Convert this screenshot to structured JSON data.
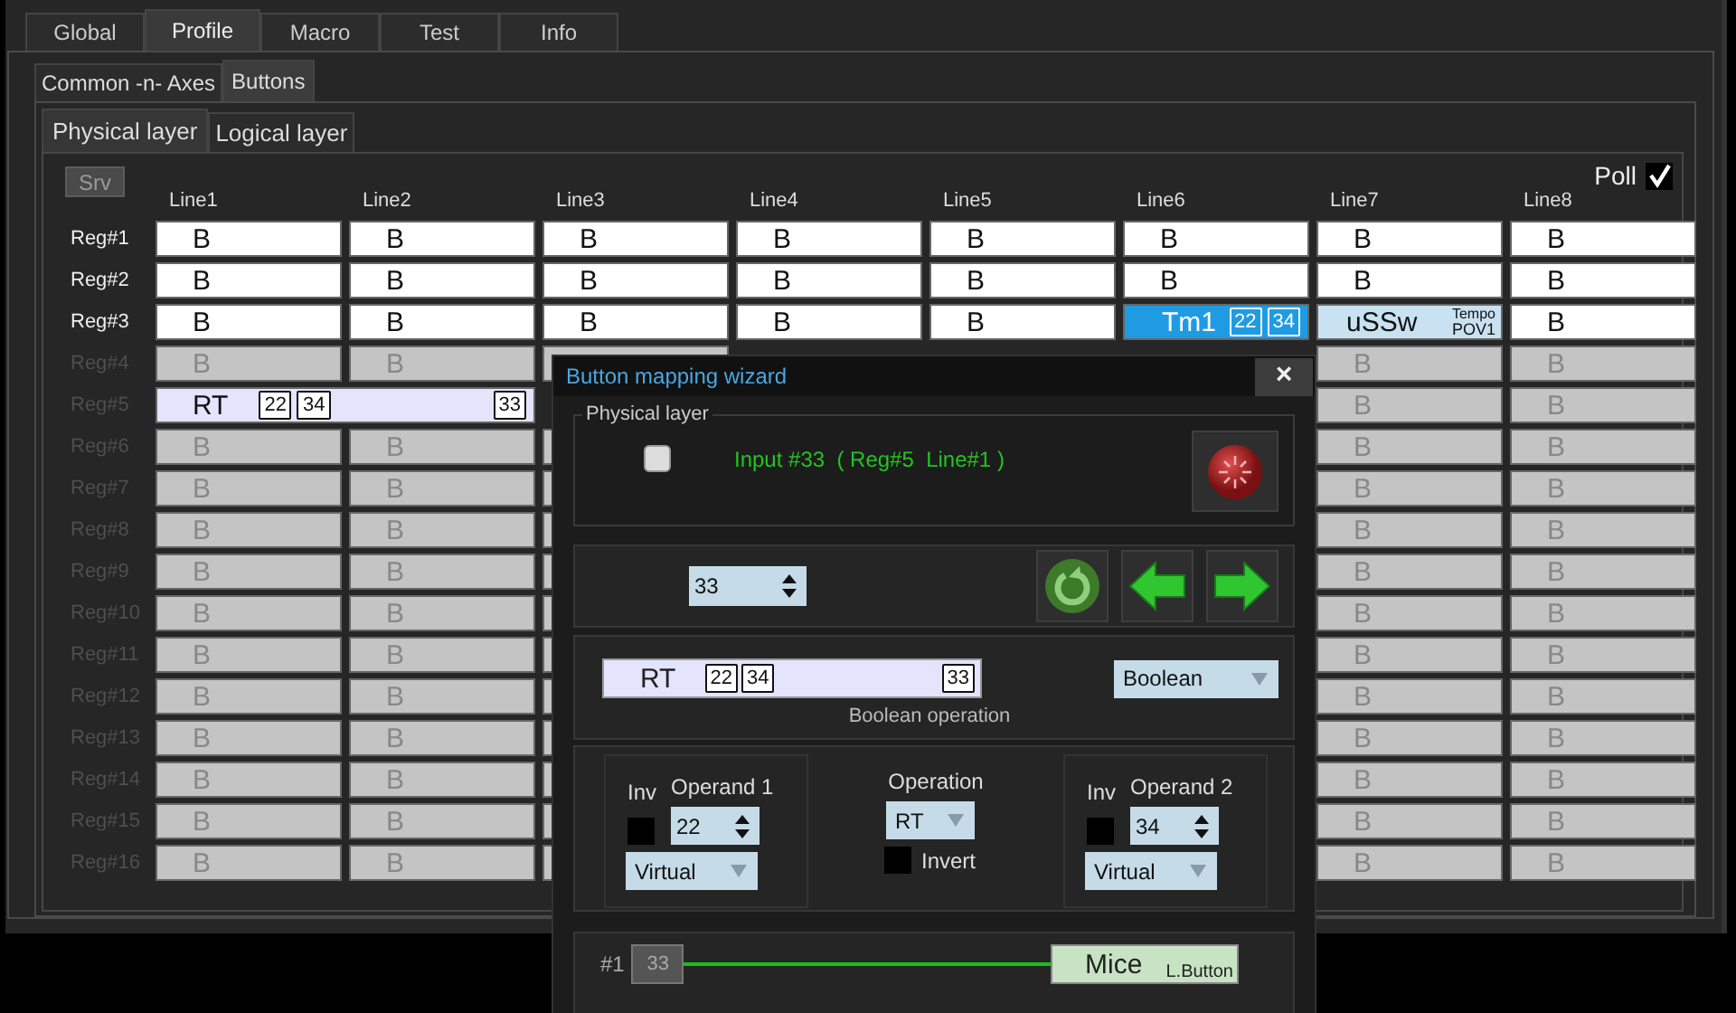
{
  "tabs": [
    {
      "label": "Global",
      "selected": false
    },
    {
      "label": "Profile",
      "selected": true
    },
    {
      "label": "Macro",
      "selected": false
    },
    {
      "label": "Test",
      "selected": false
    },
    {
      "label": "Info",
      "selected": false
    }
  ],
  "subtabs": [
    {
      "label": "Common -n- Axes",
      "selected": false
    },
    {
      "label": "Buttons",
      "selected": true
    }
  ],
  "layer_tabs": [
    {
      "label": "Physical layer",
      "selected": true
    },
    {
      "label": "Logical layer",
      "selected": false
    }
  ],
  "srv_button": "Srv",
  "poll": {
    "label": "Poll",
    "checked": true
  },
  "grid": {
    "columns": [
      "Line1",
      "Line2",
      "Line3",
      "Line4",
      "Line5",
      "Line6",
      "Line7",
      "Line8"
    ],
    "rows": [
      {
        "label": "Reg#1",
        "disabled": false,
        "cells": [
          {
            "kind": "plain",
            "text": "B"
          },
          {
            "kind": "plain",
            "text": "B"
          },
          {
            "kind": "plain",
            "text": "B"
          },
          {
            "kind": "plain",
            "text": "B"
          },
          {
            "kind": "plain",
            "text": "B"
          },
          {
            "kind": "plain",
            "text": "B"
          },
          {
            "kind": "plain",
            "text": "B"
          },
          {
            "kind": "plain",
            "text": "B"
          }
        ]
      },
      {
        "label": "Reg#2",
        "disabled": false,
        "cells": [
          {
            "kind": "plain",
            "text": "B"
          },
          {
            "kind": "plain",
            "text": "B"
          },
          {
            "kind": "plain",
            "text": "B"
          },
          {
            "kind": "plain",
            "text": "B"
          },
          {
            "kind": "plain",
            "text": "B"
          },
          {
            "kind": "plain",
            "text": "B"
          },
          {
            "kind": "plain",
            "text": "B"
          },
          {
            "kind": "plain",
            "text": "B"
          }
        ]
      },
      {
        "label": "Reg#3",
        "disabled": false,
        "cells": [
          {
            "kind": "plain",
            "text": "B"
          },
          {
            "kind": "plain",
            "text": "B"
          },
          {
            "kind": "plain",
            "text": "B"
          },
          {
            "kind": "plain",
            "text": "B"
          },
          {
            "kind": "plain",
            "text": "B"
          },
          {
            "kind": "timer",
            "text": "Tm1",
            "tags": [
              "22",
              "34"
            ]
          },
          {
            "kind": "switch",
            "text": "uSSw",
            "note_top": "Tempo",
            "note_bottom": "POV1"
          },
          {
            "kind": "plain",
            "text": "B"
          }
        ]
      },
      {
        "label": "Reg#4",
        "disabled": true,
        "cells": [
          {
            "kind": "plain",
            "text": "B"
          },
          {
            "kind": "plain",
            "text": "B"
          },
          "",
          "",
          "",
          "",
          {
            "kind": "plain",
            "text": "B"
          },
          {
            "kind": "plain",
            "text": "B"
          }
        ]
      },
      {
        "label": "Reg#5",
        "disabled": true,
        "cells": [
          {
            "kind": "logic",
            "text": "RT",
            "tags": [
              "22",
              "34"
            ],
            "input": "33"
          },
          "",
          "",
          "",
          "",
          "",
          {
            "kind": "plain",
            "text": "B"
          },
          {
            "kind": "plain",
            "text": "B"
          }
        ]
      },
      {
        "label": "Reg#6",
        "disabled": true,
        "cells": [
          {
            "kind": "plain",
            "text": "B"
          },
          {
            "kind": "plain",
            "text": "B"
          },
          "",
          "",
          "",
          "",
          {
            "kind": "plain",
            "text": "B"
          },
          {
            "kind": "plain",
            "text": "B"
          }
        ]
      },
      {
        "label": "Reg#7",
        "disabled": true,
        "cells": [
          {
            "kind": "plain",
            "text": "B"
          },
          {
            "kind": "plain",
            "text": "B"
          },
          "",
          "",
          "",
          "",
          {
            "kind": "plain",
            "text": "B"
          },
          {
            "kind": "plain",
            "text": "B"
          }
        ]
      },
      {
        "label": "Reg#8",
        "disabled": true,
        "cells": [
          {
            "kind": "plain",
            "text": "B"
          },
          {
            "kind": "plain",
            "text": "B"
          },
          "",
          "",
          "",
          "",
          {
            "kind": "plain",
            "text": "B"
          },
          {
            "kind": "plain",
            "text": "B"
          }
        ]
      },
      {
        "label": "Reg#9",
        "disabled": true,
        "cells": [
          {
            "kind": "plain",
            "text": "B"
          },
          {
            "kind": "plain",
            "text": "B"
          },
          "",
          "",
          "",
          "",
          {
            "kind": "plain",
            "text": "B"
          },
          {
            "kind": "plain",
            "text": "B"
          }
        ]
      },
      {
        "label": "Reg#10",
        "disabled": true,
        "cells": [
          {
            "kind": "plain",
            "text": "B"
          },
          {
            "kind": "plain",
            "text": "B"
          },
          "",
          "",
          "",
          "",
          {
            "kind": "plain",
            "text": "B"
          },
          {
            "kind": "plain",
            "text": "B"
          }
        ]
      },
      {
        "label": "Reg#11",
        "disabled": true,
        "cells": [
          {
            "kind": "plain",
            "text": "B"
          },
          {
            "kind": "plain",
            "text": "B"
          },
          "",
          "",
          "",
          "",
          {
            "kind": "plain",
            "text": "B"
          },
          {
            "kind": "plain",
            "text": "B"
          }
        ]
      },
      {
        "label": "Reg#12",
        "disabled": true,
        "cells": [
          {
            "kind": "plain",
            "text": "B"
          },
          {
            "kind": "plain",
            "text": "B"
          },
          "",
          "",
          "",
          "",
          {
            "kind": "plain",
            "text": "B"
          },
          {
            "kind": "plain",
            "text": "B"
          }
        ]
      },
      {
        "label": "Reg#13",
        "disabled": true,
        "cells": [
          {
            "kind": "plain",
            "text": "B"
          },
          {
            "kind": "plain",
            "text": "B"
          },
          "",
          "",
          "",
          "",
          {
            "kind": "plain",
            "text": "B"
          },
          {
            "kind": "plain",
            "text": "B"
          }
        ]
      },
      {
        "label": "Reg#14",
        "disabled": true,
        "cells": [
          {
            "kind": "plain",
            "text": "B"
          },
          {
            "kind": "plain",
            "text": "B"
          },
          "",
          "",
          "",
          "",
          {
            "kind": "plain",
            "text": "B"
          },
          {
            "kind": "plain",
            "text": "B"
          }
        ]
      },
      {
        "label": "Reg#15",
        "disabled": true,
        "cells": [
          {
            "kind": "plain",
            "text": "B"
          },
          {
            "kind": "plain",
            "text": "B"
          },
          "",
          "",
          "",
          "",
          {
            "kind": "plain",
            "text": "B"
          },
          {
            "kind": "plain",
            "text": "B"
          }
        ]
      },
      {
        "label": "Reg#16",
        "disabled": true,
        "cells": [
          {
            "kind": "plain",
            "text": "B"
          },
          {
            "kind": "plain",
            "text": "B"
          },
          "",
          "",
          "",
          "",
          {
            "kind": "plain",
            "text": "B"
          },
          {
            "kind": "plain",
            "text": "B"
          }
        ]
      }
    ]
  },
  "wizard": {
    "title": "Button mapping wizard",
    "close_label": "×",
    "physical": {
      "legend": "Physical layer",
      "checked": false,
      "input_text": "Input #33  ( Reg#5  Line#1 )"
    },
    "input_number": "33",
    "mapping": {
      "text": "RT",
      "tags": [
        "22",
        "34"
      ],
      "input": "33"
    },
    "mode": "Boolean",
    "mode_caption": "Boolean operation",
    "operand1": {
      "label": "Operand 1",
      "inv_label": "Inv",
      "inv": false,
      "value": "22",
      "source": "Virtual"
    },
    "operation": {
      "label": "Operation",
      "value": "RT",
      "invert_label": "Invert",
      "invert": false
    },
    "operand2": {
      "label": "Operand 2",
      "inv_label": "Inv",
      "inv": false,
      "value": "34",
      "source": "Virtual"
    },
    "output": {
      "index": "#1",
      "input": "33",
      "target": "Mice",
      "detail": "L.Button"
    }
  }
}
